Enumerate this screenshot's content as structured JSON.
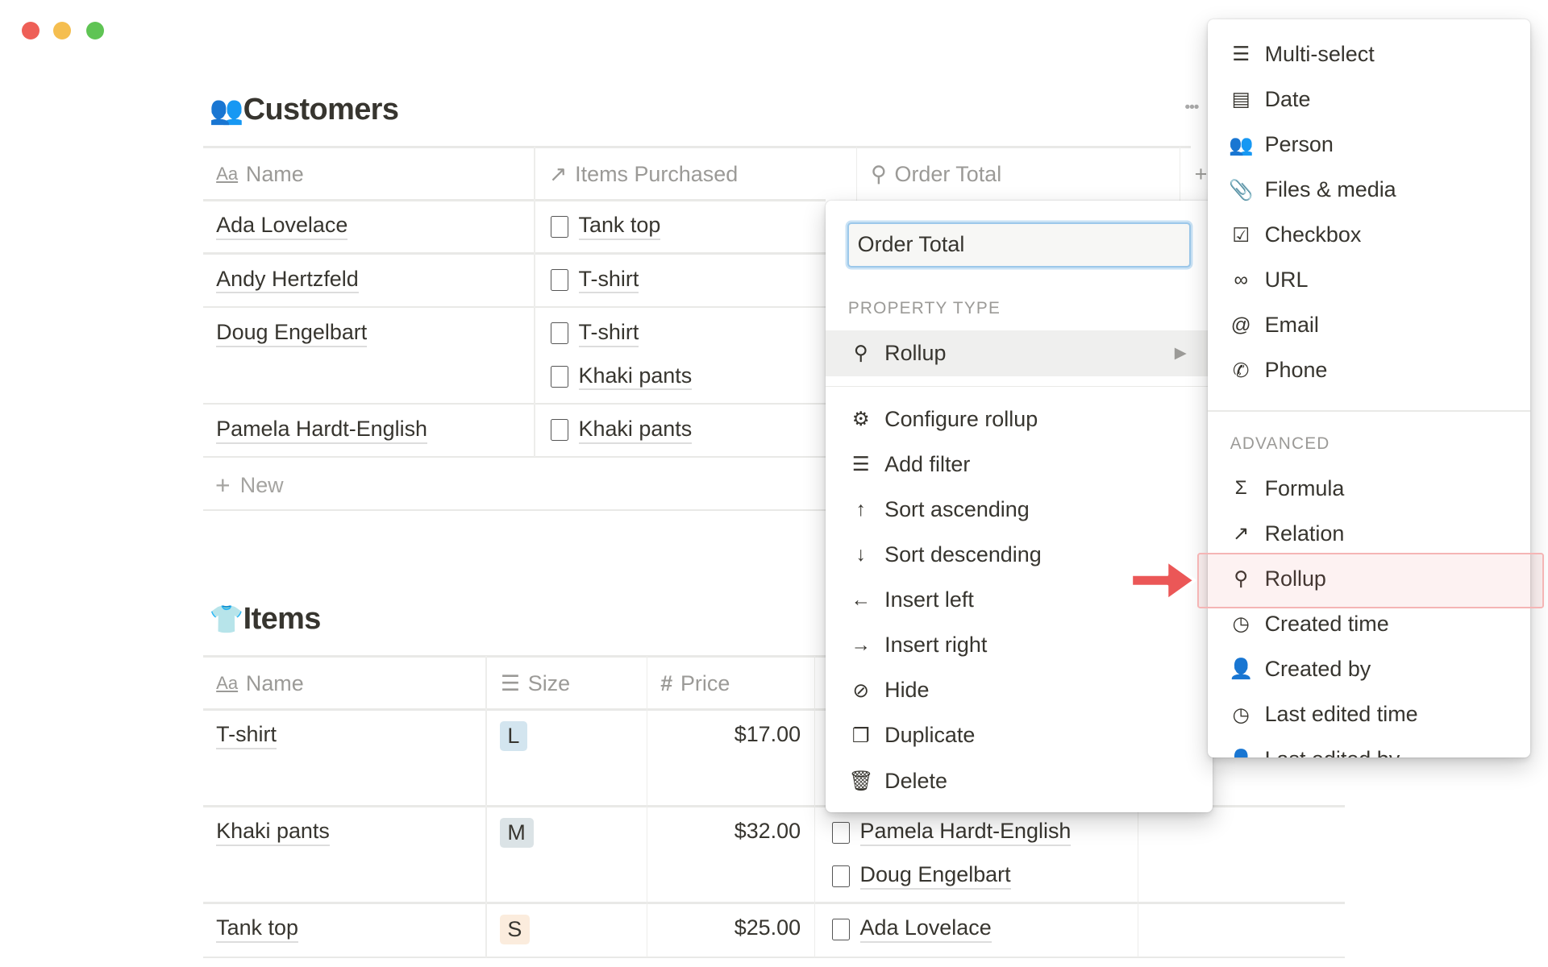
{
  "window": {
    "controls": {
      "close_color": "#ee5f57",
      "minimize_color": "#f5be4f",
      "maximize_color": "#5fc454"
    }
  },
  "customers": {
    "title": "Customers",
    "icon": "people-icon",
    "more_label": "•••",
    "columns": [
      {
        "label": "Name",
        "icon": "Aa"
      },
      {
        "label": "Items Purchased",
        "icon": "↗"
      },
      {
        "label": "Order Total",
        "icon": "search-icon"
      }
    ],
    "add_column": "+",
    "rows": [
      {
        "name": "Ada Lovelace",
        "items": [
          "Tank top"
        ]
      },
      {
        "name": "Andy Hertzfeld",
        "items": [
          "T-shirt"
        ]
      },
      {
        "name": "Doug Engelbart",
        "items": [
          "T-shirt",
          "Khaki pants"
        ]
      },
      {
        "name": "Pamela Hardt-English",
        "items": [
          "Khaki pants"
        ]
      }
    ],
    "new_label": "New"
  },
  "items": {
    "title": "Items",
    "icon": "shirt-icon",
    "columns": [
      {
        "label": "Name",
        "icon": "Aa"
      },
      {
        "label": "Size",
        "icon": "list-icon"
      },
      {
        "label": "Price",
        "icon": "#"
      }
    ],
    "rows": [
      {
        "name": "T-shirt",
        "size": "L",
        "size_color": "#d3e5ef",
        "price": "$17.00",
        "customers": []
      },
      {
        "name": "Khaki pants",
        "size": "M",
        "size_color": "#dbe3e6",
        "price": "$32.00",
        "customers": [
          "Pamela Hardt-English",
          "Doug Engelbart"
        ]
      },
      {
        "name": "Tank top",
        "size": "S",
        "size_color": "#fbecdd",
        "price": "$25.00",
        "customers": [
          "Ada Lovelace"
        ]
      }
    ]
  },
  "property_menu": {
    "name_value": "Order Total",
    "type_label": "PROPERTY TYPE",
    "type_value": "Rollup",
    "actions": [
      {
        "label": "Configure rollup",
        "icon": "gear-icon",
        "glyph": "⚙"
      },
      {
        "label": "Add filter",
        "icon": "filter-icon",
        "glyph": "☰"
      },
      {
        "label": "Sort ascending",
        "icon": "arrow-up-icon",
        "glyph": "↑"
      },
      {
        "label": "Sort descending",
        "icon": "arrow-down-icon",
        "glyph": "↓"
      },
      {
        "label": "Insert left",
        "icon": "arrow-left-icon",
        "glyph": "←"
      },
      {
        "label": "Insert right",
        "icon": "arrow-right-icon",
        "glyph": "→"
      },
      {
        "label": "Hide",
        "icon": "eye-slash-icon",
        "glyph": "⊘"
      },
      {
        "label": "Duplicate",
        "icon": "duplicate-icon",
        "glyph": "❐"
      },
      {
        "label": "Delete",
        "icon": "trash-icon",
        "glyph": "🗑"
      }
    ]
  },
  "type_menu": {
    "basic": [
      {
        "label": "Multi-select",
        "icon": "list-icon",
        "glyph": "☰"
      },
      {
        "label": "Date",
        "icon": "calendar-icon",
        "glyph": "▤"
      },
      {
        "label": "Person",
        "icon": "people-icon",
        "glyph": "👥"
      },
      {
        "label": "Files & media",
        "icon": "paperclip-icon",
        "glyph": "📎"
      },
      {
        "label": "Checkbox",
        "icon": "checkbox-icon",
        "glyph": "☑"
      },
      {
        "label": "URL",
        "icon": "link-icon",
        "glyph": "∞"
      },
      {
        "label": "Email",
        "icon": "at-icon",
        "glyph": "@"
      },
      {
        "label": "Phone",
        "icon": "phone-icon",
        "glyph": "✆"
      }
    ],
    "advanced_label": "ADVANCED",
    "advanced": [
      {
        "label": "Formula",
        "icon": "sigma-icon",
        "glyph": "Σ"
      },
      {
        "label": "Relation",
        "icon": "arrow-up-right-icon",
        "glyph": "↗"
      },
      {
        "label": "Rollup",
        "icon": "search-icon",
        "glyph": "⚲",
        "highlighted": true
      },
      {
        "label": "Created time",
        "icon": "clock-icon",
        "glyph": "◷"
      },
      {
        "label": "Created by",
        "icon": "person-icon",
        "glyph": "👤"
      },
      {
        "label": "Last edited time",
        "icon": "clock-icon",
        "glyph": "◷"
      },
      {
        "label": "Last edited by",
        "icon": "person-icon",
        "glyph": "👤"
      }
    ],
    "highlight_color": "#eb5757"
  }
}
